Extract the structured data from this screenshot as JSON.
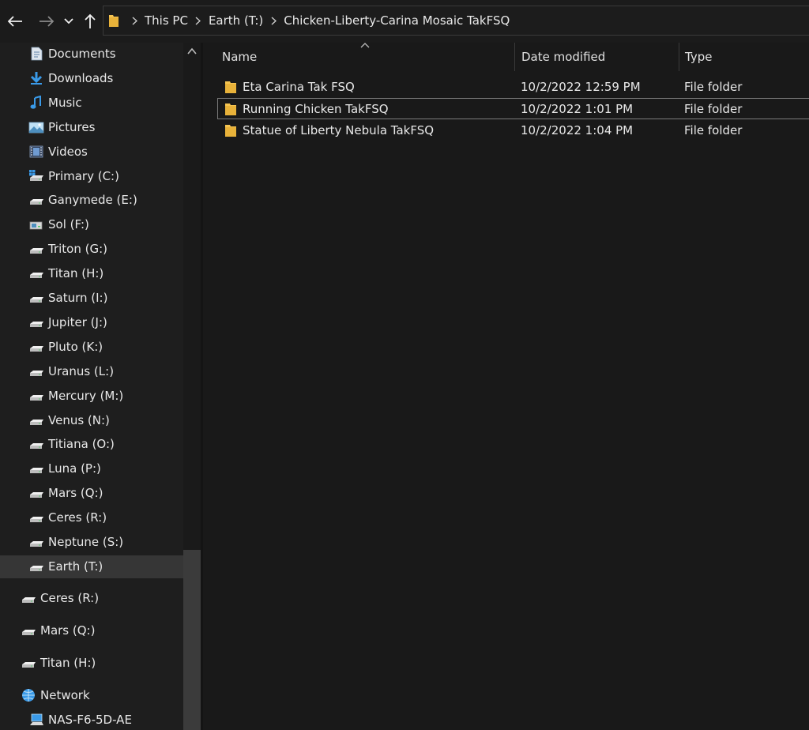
{
  "toolbar": {
    "back_icon": "arrow-left-icon",
    "forward_icon": "arrow-right-icon",
    "recent_icon": "chevron-down-icon",
    "up_icon": "arrow-up-icon"
  },
  "address": {
    "breadcrumbs": [
      "This PC",
      "Earth (T:)",
      "Chicken-Liberty-Carina Mosaic TakFSQ"
    ]
  },
  "sidebar": {
    "items": [
      {
        "label": "Documents",
        "icon": "documents-icon"
      },
      {
        "label": "Downloads",
        "icon": "downloads-icon"
      },
      {
        "label": "Music",
        "icon": "music-icon"
      },
      {
        "label": "Pictures",
        "icon": "pictures-icon"
      },
      {
        "label": "Videos",
        "icon": "videos-icon"
      },
      {
        "label": "Primary (C:)",
        "icon": "windows-drive-icon"
      },
      {
        "label": "Ganymede (E:)",
        "icon": "drive-icon"
      },
      {
        "label": "Sol (F:)",
        "icon": "removable-drive-icon"
      },
      {
        "label": "Triton (G:)",
        "icon": "drive-icon"
      },
      {
        "label": "Titan (H:)",
        "icon": "drive-icon"
      },
      {
        "label": "Saturn (I:)",
        "icon": "drive-icon"
      },
      {
        "label": "Jupiter (J:)",
        "icon": "drive-icon"
      },
      {
        "label": "Pluto (K:)",
        "icon": "drive-icon"
      },
      {
        "label": "Uranus (L:)",
        "icon": "drive-icon"
      },
      {
        "label": "Mercury (M:)",
        "icon": "drive-icon"
      },
      {
        "label": "Venus (N:)",
        "icon": "drive-icon"
      },
      {
        "label": "Titiana (O:)",
        "icon": "drive-icon"
      },
      {
        "label": "Luna (P:)",
        "icon": "drive-icon"
      },
      {
        "label": "Mars (Q:)",
        "icon": "drive-icon"
      },
      {
        "label": "Ceres (R:)",
        "icon": "drive-icon"
      },
      {
        "label": "Neptune (S:)",
        "icon": "drive-icon"
      },
      {
        "label": "Earth (T:)",
        "icon": "drive-icon",
        "selected": true
      }
    ],
    "root_items": [
      {
        "label": "Ceres (R:)",
        "icon": "drive-icon"
      },
      {
        "label": "Mars (Q:)",
        "icon": "drive-icon"
      },
      {
        "label": "Titan (H:)",
        "icon": "drive-icon"
      },
      {
        "label": "Network",
        "icon": "network-icon"
      },
      {
        "label": "NAS-F6-5D-AE",
        "icon": "computer-icon"
      }
    ]
  },
  "columns": {
    "name": "Name",
    "date_modified": "Date modified",
    "type": "Type"
  },
  "files": [
    {
      "name": "Eta Carina Tak FSQ",
      "date_modified": "10/2/2022 12:59 PM",
      "type": "File folder"
    },
    {
      "name": "Running Chicken TakFSQ",
      "date_modified": "10/2/2022 1:01 PM",
      "type": "File folder",
      "focused": true
    },
    {
      "name": "Statue of Liberty Nebula TakFSQ",
      "date_modified": "10/2/2022 1:04 PM",
      "type": "File folder"
    }
  ],
  "colors": {
    "folder": "#f5c451",
    "accent_blue": "#3a9ae8",
    "selection": "#363636"
  }
}
